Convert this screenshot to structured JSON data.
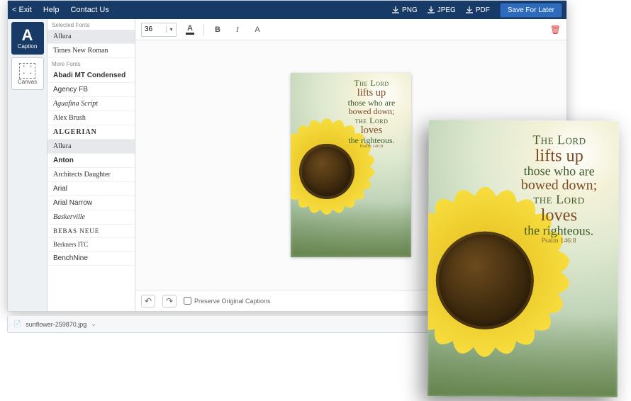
{
  "topbar": {
    "exit": "< Exit",
    "help": "Help",
    "contact": "Contact Us",
    "png": "PNG",
    "jpeg": "JPEG",
    "pdf": "PDF",
    "save": "Save For Later"
  },
  "tools": {
    "caption": {
      "glyph": "A",
      "label": "Caption"
    },
    "canvas": {
      "glyph": "⸬",
      "label": "Canvas"
    }
  },
  "fonts": {
    "selected_header": "Selected Fonts",
    "selected": [
      {
        "label": "Allura",
        "cls": "ff-allura",
        "sel": true
      },
      {
        "label": "Times New Roman",
        "cls": "ff-tnr"
      }
    ],
    "more_header": "More Fonts",
    "more": [
      {
        "label": "Abadi MT Condensed",
        "cls": "ff-abadi"
      },
      {
        "label": "Agency FB",
        "cls": "ff-agency"
      },
      {
        "label": "Aguafina Script",
        "cls": "ff-aguafina"
      },
      {
        "label": "Alex Brush",
        "cls": "ff-alex"
      },
      {
        "label": "ALGERIAN",
        "cls": "ff-algerian"
      },
      {
        "label": "Allura",
        "cls": "ff-allura",
        "sel": true
      },
      {
        "label": "Anton",
        "cls": "ff-anton"
      },
      {
        "label": "Architects Daughter",
        "cls": "ff-arch"
      },
      {
        "label": "Arial",
        "cls": "ff-arial"
      },
      {
        "label": "Arial Narrow",
        "cls": "ff-arialn"
      },
      {
        "label": "Baskerville",
        "cls": "ff-bask"
      },
      {
        "label": "BEBAS NEUE",
        "cls": "ff-bebas"
      },
      {
        "label": "Berkners ITC",
        "cls": "ff-berk"
      },
      {
        "label": "BenchNine",
        "cls": "ff-bench"
      }
    ]
  },
  "format": {
    "size": "36",
    "bold": "B",
    "italic": "I",
    "color": "A"
  },
  "bottom": {
    "undo": "↶",
    "redo": "↷",
    "preserve": "Preserve Original Captions"
  },
  "download_chip": "sunflower-259870.jpg",
  "verse": {
    "l1": "The Lord",
    "l2": "lifts up",
    "l3": "those who are",
    "l4": "bowed down;",
    "l5": "the Lord",
    "l6": "loves",
    "l7": "the righteous.",
    "ref": "Psalm 146:8"
  },
  "colors": {
    "brand": "#173a66",
    "accent": "#2f6bbd"
  }
}
